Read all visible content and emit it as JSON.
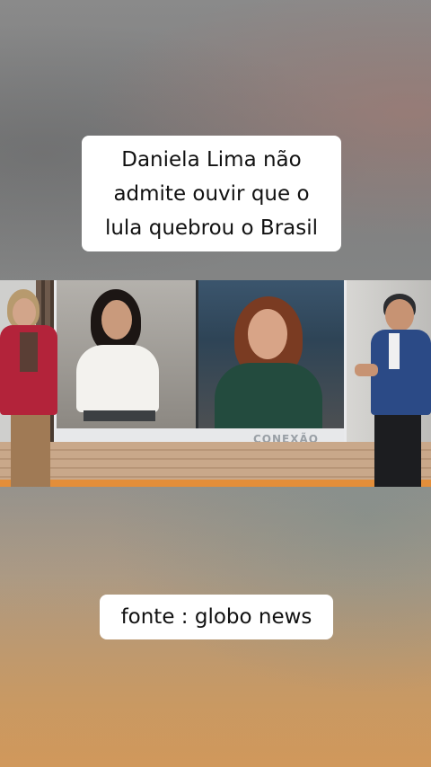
{
  "caption": {
    "text": "Daniela Lima não\nadmite ouvir que o\nlula quebrou o Brasil"
  },
  "source": {
    "text": "fonte : globo news"
  },
  "video": {
    "screen_logo": "CONEXÃO"
  }
}
